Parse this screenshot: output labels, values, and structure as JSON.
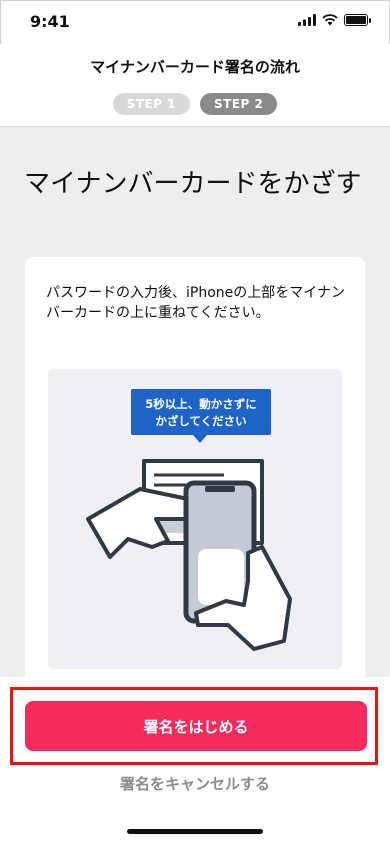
{
  "status_bar": {
    "time": "9:41"
  },
  "header": {
    "title": "マイナンバーカード署名の流れ",
    "steps": [
      {
        "label": "STEP 1",
        "state": "done"
      },
      {
        "label": "STEP 2",
        "state": "current"
      }
    ]
  },
  "main": {
    "heading": "マイナンバーカードをかざす",
    "instruction": "パスワードの入力後、iPhoneの上部をマイナンバーカードの上に重ねてください。",
    "illustration": {
      "callout_line1": "5秒以上、動かさずに",
      "callout_line2": "かざしてください"
    }
  },
  "footer": {
    "primary_button": "署名をはじめる",
    "cancel_link": "署名をキャンセルする"
  },
  "colors": {
    "primary": "#f42b5c",
    "callout": "#1e63c6",
    "highlight": "#e31616"
  }
}
